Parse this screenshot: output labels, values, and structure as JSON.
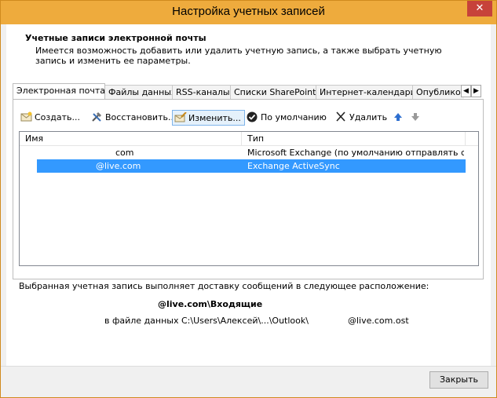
{
  "window": {
    "title": "Настройка учетных записей",
    "close_glyph": "✕"
  },
  "header": {
    "title": "Учетные записи электронной почты",
    "description": "Имеется возможность добавить или удалить учетную запись, а также выбрать учетную запись и изменить ее параметры."
  },
  "tabs": [
    {
      "label": "Электронная почта",
      "active": true
    },
    {
      "label": "Файлы данных",
      "active": false
    },
    {
      "label": "RSS-каналы",
      "active": false
    },
    {
      "label": "Списки SharePoint",
      "active": false
    },
    {
      "label": "Интернет-календари",
      "active": false
    },
    {
      "label": "Опублико",
      "active": false
    }
  ],
  "tab_scroll": {
    "left": "◀",
    "right": "▶"
  },
  "toolbar": {
    "create_label": "Создать...",
    "repair_label": "Восстановить...",
    "change_label": "Изменить...",
    "default_label": "По умолчанию",
    "remove_label": "Удалить",
    "up_glyph": "🡅",
    "down_glyph": "🡇"
  },
  "accounts_table": {
    "columns": [
      "Имя",
      "Тип"
    ],
    "rows": [
      {
        "name": "com",
        "type": "Microsoft Exchange (по умолчанию отправлять с ...",
        "selected": false
      },
      {
        "name": "@live.com",
        "type": "Exchange ActiveSync",
        "selected": true
      }
    ]
  },
  "delivery_info": {
    "label": "Выбранная учетная запись выполняет доставку сообщений в следующее расположение:",
    "location": "@live.com\\Входящие",
    "datafile_prefix": "в файле данных C:\\Users\\Алексей\\...\\Outlook\\",
    "datafile_suffix": "@live.com.ost"
  },
  "footer": {
    "close_label": "Закрыть"
  },
  "colors": {
    "titlebar": "#eeab3d",
    "selection": "#3399ff",
    "close_button": "#c7423a"
  }
}
